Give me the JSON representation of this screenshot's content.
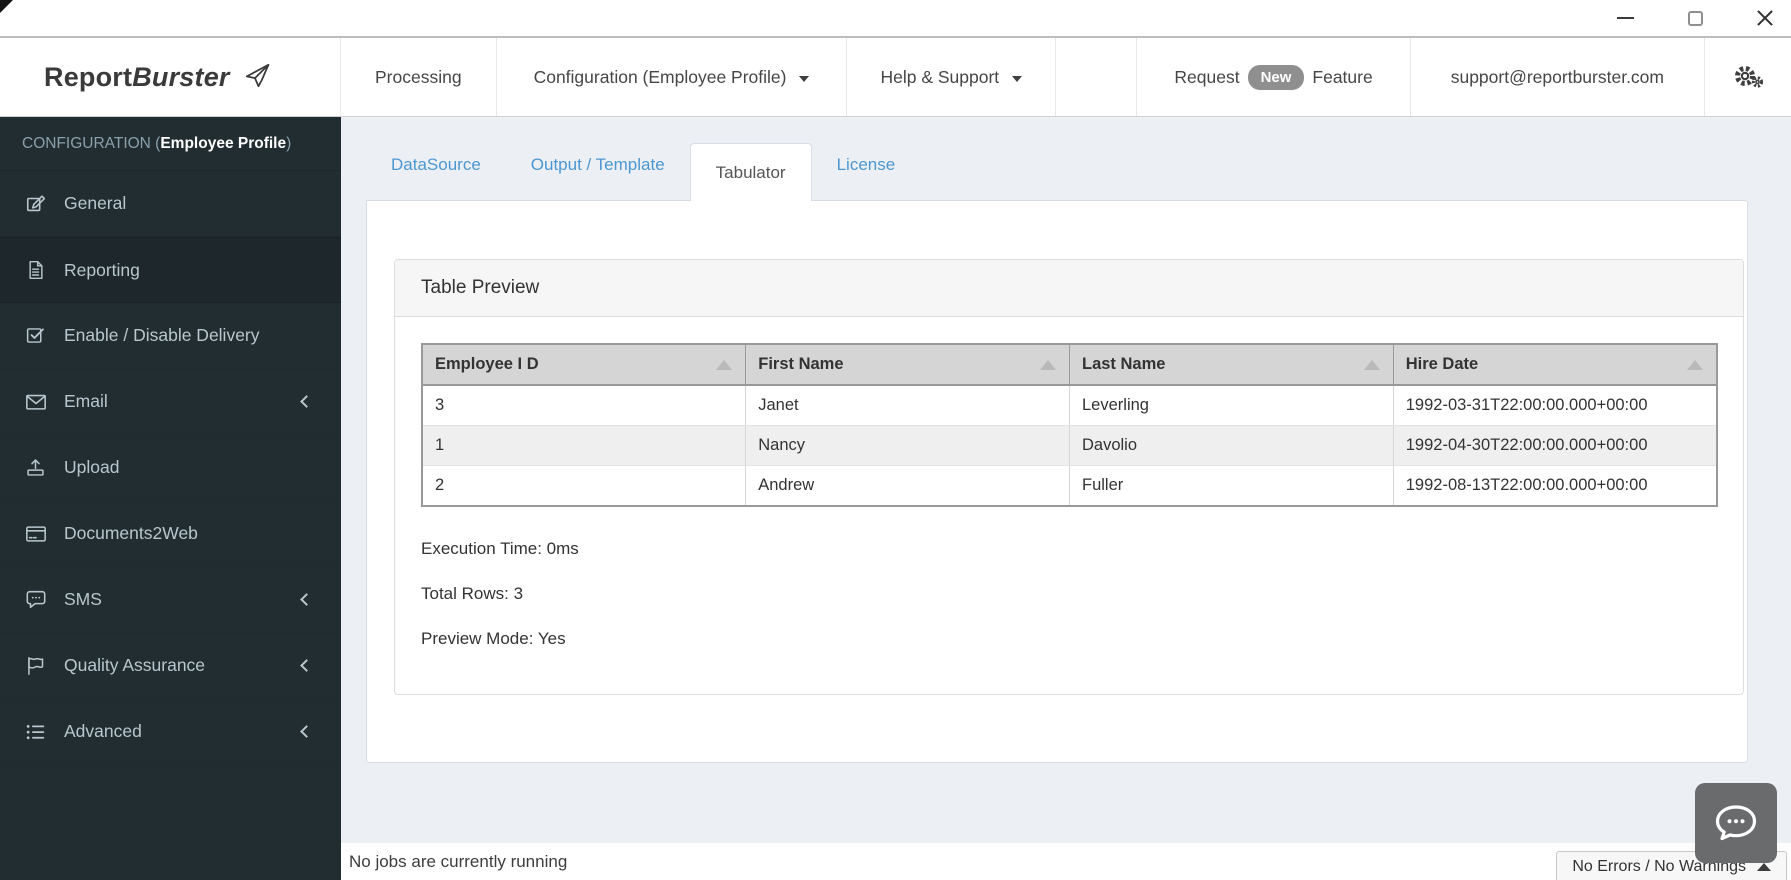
{
  "navbar": {
    "brand": {
      "bold": "Report",
      "italic": "Burster"
    },
    "processing": "Processing",
    "configuration": "Configuration (Employee Profile)",
    "help": "Help & Support",
    "request_feature": {
      "prefix": "Request",
      "badge": "New",
      "suffix": "Feature"
    },
    "support_email": "support@reportburster.com"
  },
  "sidebar": {
    "header": {
      "prefix": "CONFIGURATION (",
      "highlight": "Employee Profile",
      "suffix": ")"
    },
    "items": [
      {
        "label": "General",
        "icon": "edit-icon"
      },
      {
        "label": "Reporting",
        "icon": "file-text-icon",
        "active": true
      },
      {
        "label": "Enable / Disable Delivery",
        "icon": "check-square-icon"
      },
      {
        "label": "Email",
        "icon": "envelope-icon",
        "expandable": true
      },
      {
        "label": "Upload",
        "icon": "upload-icon"
      },
      {
        "label": "Documents2Web",
        "icon": "card-icon"
      },
      {
        "label": "SMS",
        "icon": "comment-icon",
        "expandable": true
      },
      {
        "label": "Quality Assurance",
        "icon": "flag-icon",
        "expandable": true
      },
      {
        "label": "Advanced",
        "icon": "list-icon",
        "expandable": true
      }
    ]
  },
  "tabs": [
    {
      "label": "DataSource"
    },
    {
      "label": "Output / Template"
    },
    {
      "label": "Tabulator",
      "active": true
    },
    {
      "label": "License"
    }
  ],
  "panel": {
    "title": "Table Preview",
    "table": {
      "columns": [
        "Employee I D",
        "First Name",
        "Last Name",
        "Hire Date"
      ],
      "rows": [
        [
          "3",
          "Janet",
          "Leverling",
          "1992-03-31T22:00:00.000+00:00"
        ],
        [
          "1",
          "Nancy",
          "Davolio",
          "1992-04-30T22:00:00.000+00:00"
        ],
        [
          "2",
          "Andrew",
          "Fuller",
          "1992-08-13T22:00:00.000+00:00"
        ]
      ]
    },
    "stats": {
      "execution_time": "Execution Time: 0ms",
      "total_rows": "Total Rows: 3",
      "preview_mode": "Preview Mode: Yes"
    }
  },
  "statusbar": {
    "left": "No jobs are currently running",
    "right": "No Errors / No Warnings"
  },
  "colors": {
    "sidebar_bg": "#222d32",
    "sidebar_active_bg": "#1e282c",
    "sidebar_text": "#b8c7ce",
    "link_blue": "#4c97d0",
    "content_bg": "#ecf0f5",
    "badge_gray": "#8f8f8f",
    "table_header_bg": "#d5d5d5",
    "chat_fab_bg": "#6a6b6d"
  }
}
